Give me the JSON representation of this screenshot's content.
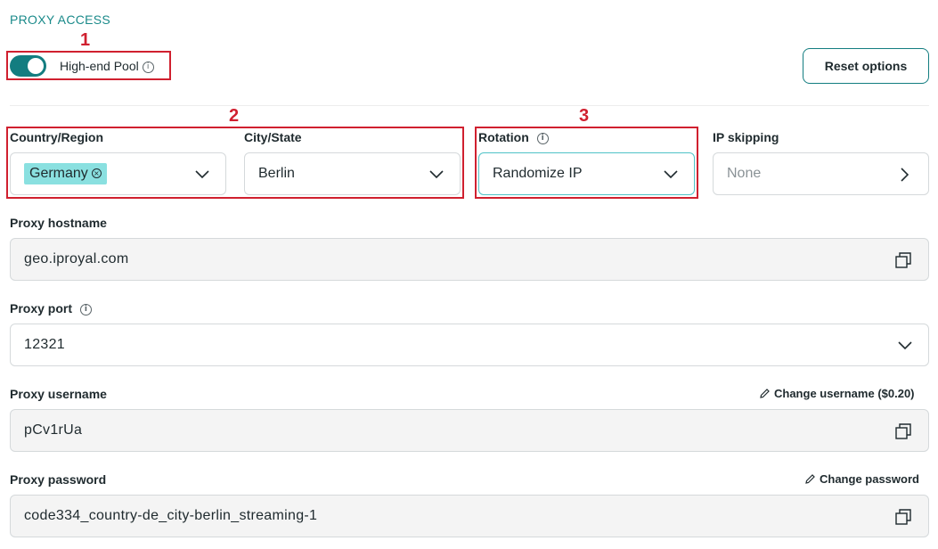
{
  "section": {
    "title": "PROXY ACCESS"
  },
  "annotations": [
    "1",
    "2",
    "3"
  ],
  "pool": {
    "label": "High-end Pool",
    "enabled": true
  },
  "reset": {
    "label": "Reset options"
  },
  "country": {
    "label": "Country/Region",
    "value": "Germany"
  },
  "city": {
    "label": "City/State",
    "value": "Berlin"
  },
  "rotation": {
    "label": "Rotation",
    "value": "Randomize IP"
  },
  "skipping": {
    "label": "IP skipping",
    "value": "None"
  },
  "hostname": {
    "label": "Proxy hostname",
    "value": "geo.iproyal.com"
  },
  "port": {
    "label": "Proxy port",
    "value": "12321"
  },
  "username": {
    "label": "Proxy username",
    "value": "pCv1rUa",
    "action": "Change username ($0.20)"
  },
  "password": {
    "label": "Proxy password",
    "value": "code334_country-de_city-berlin_streaming-1",
    "action": "Change password"
  },
  "colors": {
    "accent": "#137d80",
    "annotation": "#d0202f",
    "chip": "#8ae0e0"
  }
}
